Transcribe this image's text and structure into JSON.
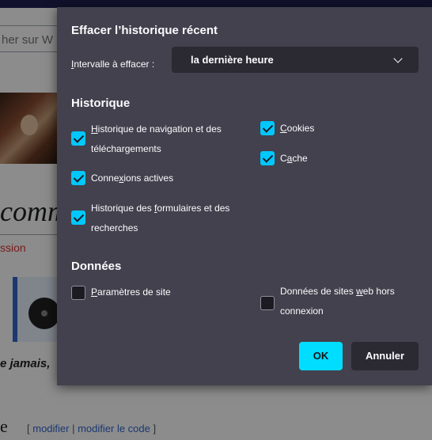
{
  "background_page": {
    "search_partial": "her sur W",
    "heading_partial": "comm",
    "red_link_partial": "ssion",
    "bold_partial": "e jamais,",
    "heading_e": "e",
    "edit_links": {
      "open": "[ ",
      "modifier": "modifier",
      "sep": " | ",
      "modifier_code": "modifier le code",
      "close": " ]"
    }
  },
  "dialog": {
    "title": "Effacer l’historique récent",
    "range": {
      "label_accel": "I",
      "label_rest": "ntervalle à effacer :",
      "selected": "la dernière heure"
    },
    "history_section": "Historique",
    "history_items": [
      {
        "pre": "",
        "acc": "H",
        "post": "istorique de navigation et des",
        "line2": "téléchargements",
        "checked": true
      },
      {
        "pre": "Conne",
        "acc": "x",
        "post": "ions actives",
        "checked": true
      },
      {
        "pre": "Historique des ",
        "acc": "f",
        "post": "ormulaires et des",
        "line2": "recherches",
        "checked": true
      },
      {
        "pre": "",
        "acc": "C",
        "post": "ookies",
        "checked": true
      },
      {
        "pre": "C",
        "acc": "a",
        "post": "che",
        "checked": true
      }
    ],
    "data_section": "Données",
    "data_items": [
      {
        "pre": "",
        "acc": "P",
        "post": "aramètres de site",
        "checked": false
      },
      {
        "pre": "Données de sites ",
        "acc": "w",
        "post": "eb hors",
        "line2": "connexion",
        "checked": false
      }
    ],
    "ok_label": "OK",
    "cancel_label": "Annuler"
  },
  "colors": {
    "dialog_bg": "#42414d",
    "accent": "#00ddff",
    "checkbox_on": "#00c8ff",
    "field_bg": "#2b2a33"
  }
}
